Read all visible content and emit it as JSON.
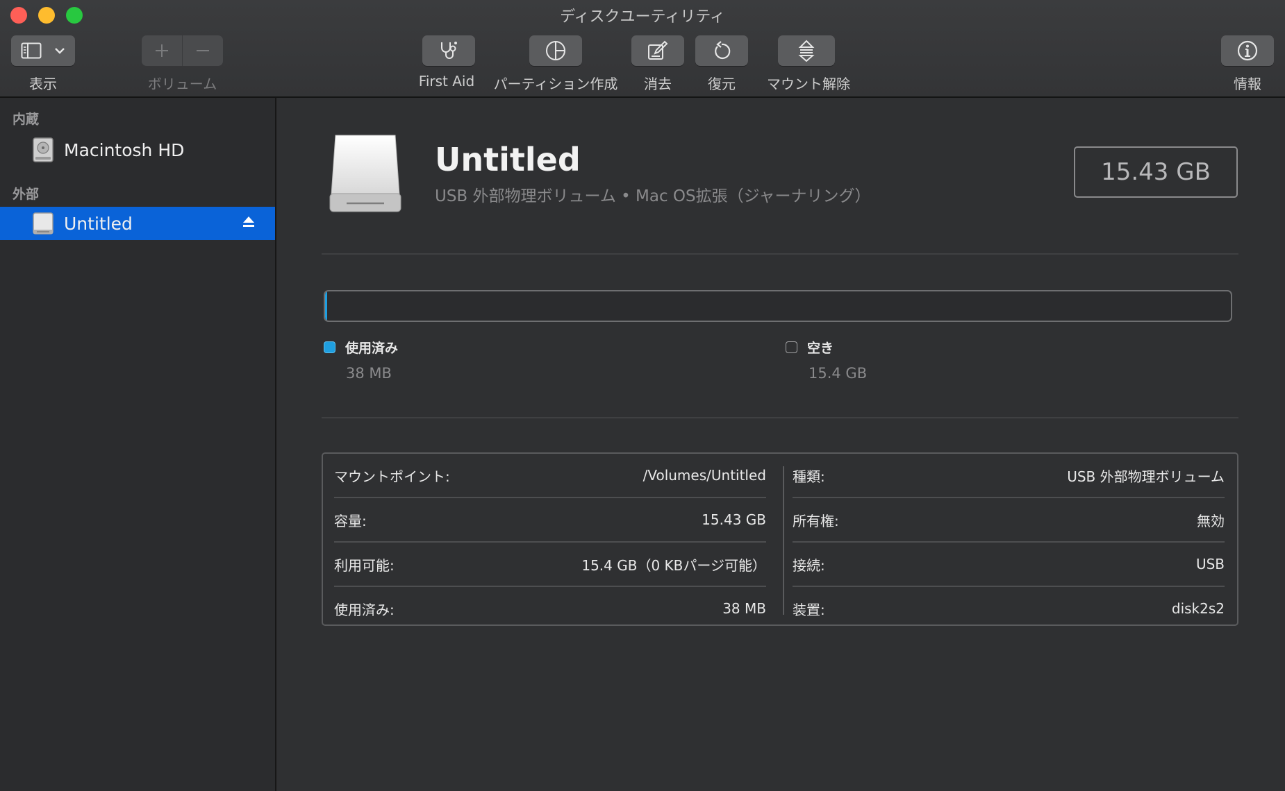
{
  "window": {
    "title": "ディスクユーティリティ"
  },
  "toolbar": {
    "view_label": "表示",
    "volume_label": "ボリューム",
    "first_aid_label": "First Aid",
    "partition_label": "パーティション作成",
    "erase_label": "消去",
    "restore_label": "復元",
    "unmount_label": "マウント解除",
    "info_label": "情報"
  },
  "sidebar": {
    "internal_label": "内蔵",
    "external_label": "外部",
    "internal_items": [
      {
        "name": "Macintosh HD",
        "icon": "internal-disk-icon"
      }
    ],
    "external_items": [
      {
        "name": "Untitled",
        "icon": "external-disk-icon",
        "selected": true
      }
    ]
  },
  "volume": {
    "name": "Untitled",
    "subtitle": "USB 外部物理ボリューム • Mac OS拡張（ジャーナリング）",
    "size": "15.43 GB"
  },
  "usage": {
    "used_fraction": 0.0025,
    "used_label": "使用済み",
    "used_value": "38 MB",
    "free_label": "空き",
    "free_value": "15.4 GB",
    "used_color": "#1f9fe0"
  },
  "info": {
    "left": [
      {
        "key": "マウントポイント:",
        "value": "/Volumes/Untitled"
      },
      {
        "key": "容量:",
        "value": "15.43 GB"
      },
      {
        "key": "利用可能:",
        "value": "15.4 GB（0 KBパージ可能）"
      },
      {
        "key": "使用済み:",
        "value": "38 MB"
      }
    ],
    "right": [
      {
        "key": "種類:",
        "value": "USB 外部物理ボリューム"
      },
      {
        "key": "所有権:",
        "value": "無効"
      },
      {
        "key": "接続:",
        "value": "USB"
      },
      {
        "key": "装置:",
        "value": "disk2s2"
      }
    ]
  },
  "colors": {
    "accent": "#0a63d8",
    "close": "#fe5f57",
    "minimize": "#febc2e",
    "zoom": "#28c840"
  }
}
